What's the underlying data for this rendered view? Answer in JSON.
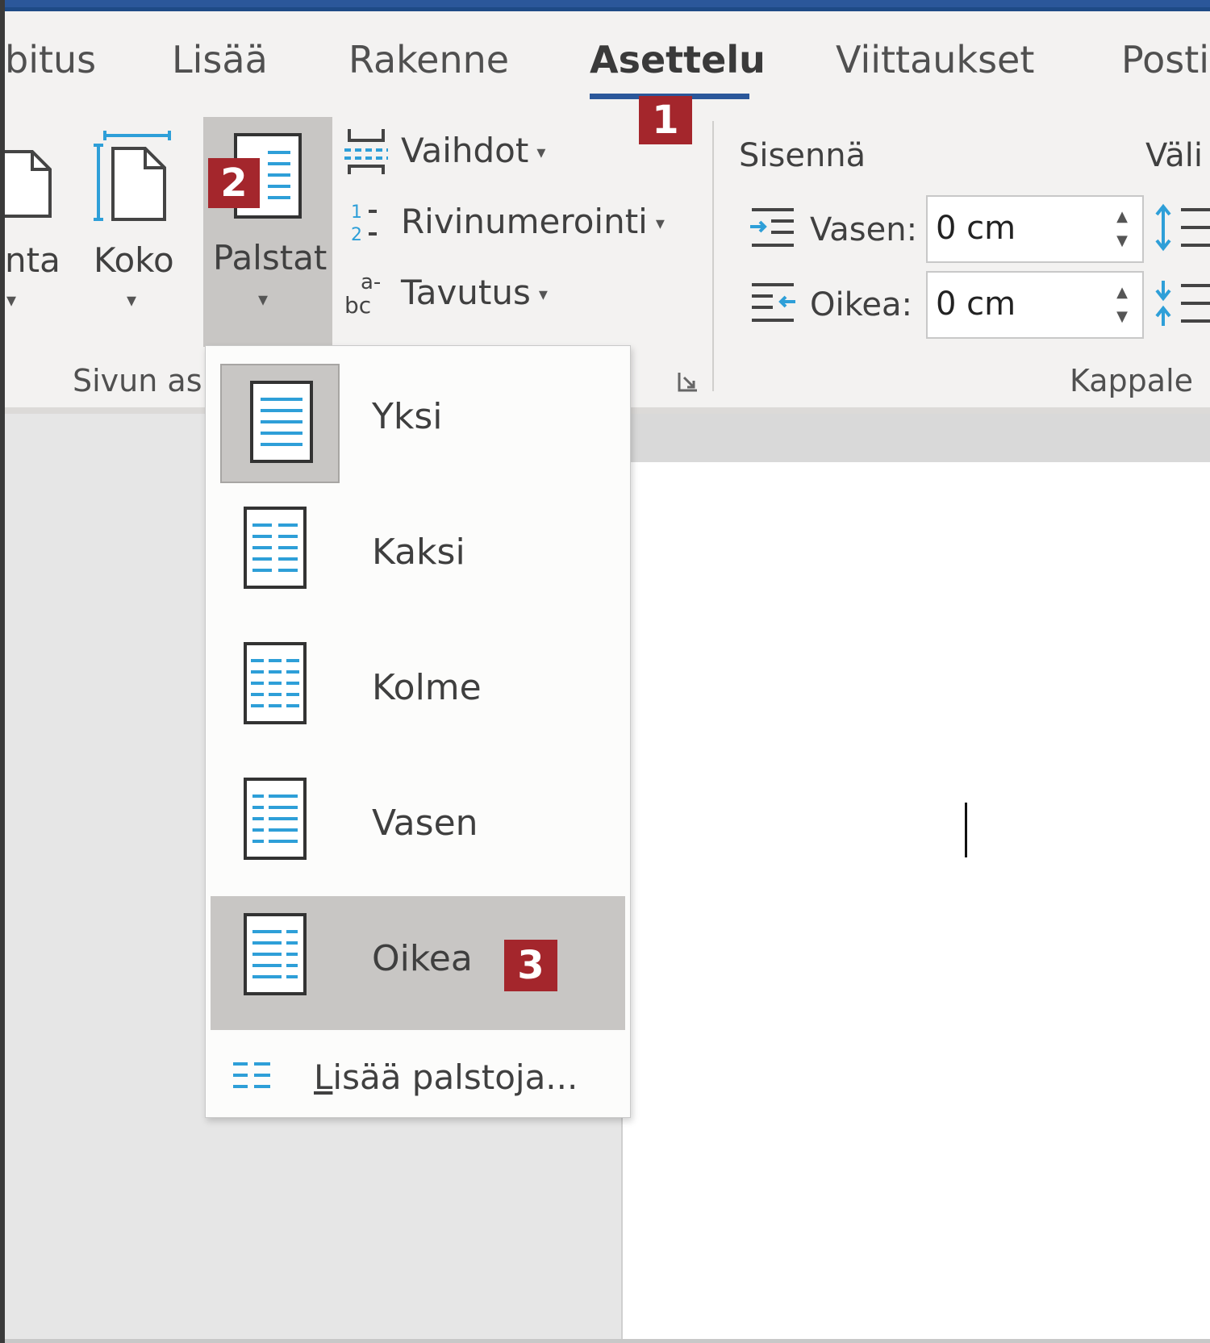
{
  "ribbon": {
    "tabs": [
      "bitus",
      "Lisää",
      "Rakenne",
      "Asettelu",
      "Viittaukset",
      "Posti"
    ],
    "active_tab": "Asettelu"
  },
  "badges": {
    "one": "1",
    "two": "2",
    "three": "3"
  },
  "page_setup": {
    "orientation_partial": "nta",
    "size_label": "Koko",
    "columns_label": "Palstat",
    "breaks_label": "Vaihdot",
    "line_numbers_label": "Rivinumerointi",
    "hyphenation_label": "Tavutus",
    "group_label_partial": "Sivun as"
  },
  "paragraph": {
    "indent_title": "Sisennä",
    "spacing_title_partial": "Väli",
    "left_label": "Vasen:",
    "left_value": "0 cm",
    "right_label": "Oikea:",
    "right_value": "0 cm",
    "group_label": "Kappale"
  },
  "columns_menu": {
    "items": [
      {
        "label": "Yksi",
        "icon": "one-column-icon"
      },
      {
        "label": "Kaksi",
        "icon": "two-columns-icon"
      },
      {
        "label": "Kolme",
        "icon": "three-columns-icon"
      },
      {
        "label": "Vasen",
        "icon": "left-column-icon"
      },
      {
        "label": "Oikea",
        "icon": "right-column-icon"
      }
    ],
    "more_label": "Lisää palstoja..."
  },
  "colors": {
    "accent": "#2b579a",
    "badge": "#a4262c",
    "icon_blue": "#2e9fd8"
  }
}
